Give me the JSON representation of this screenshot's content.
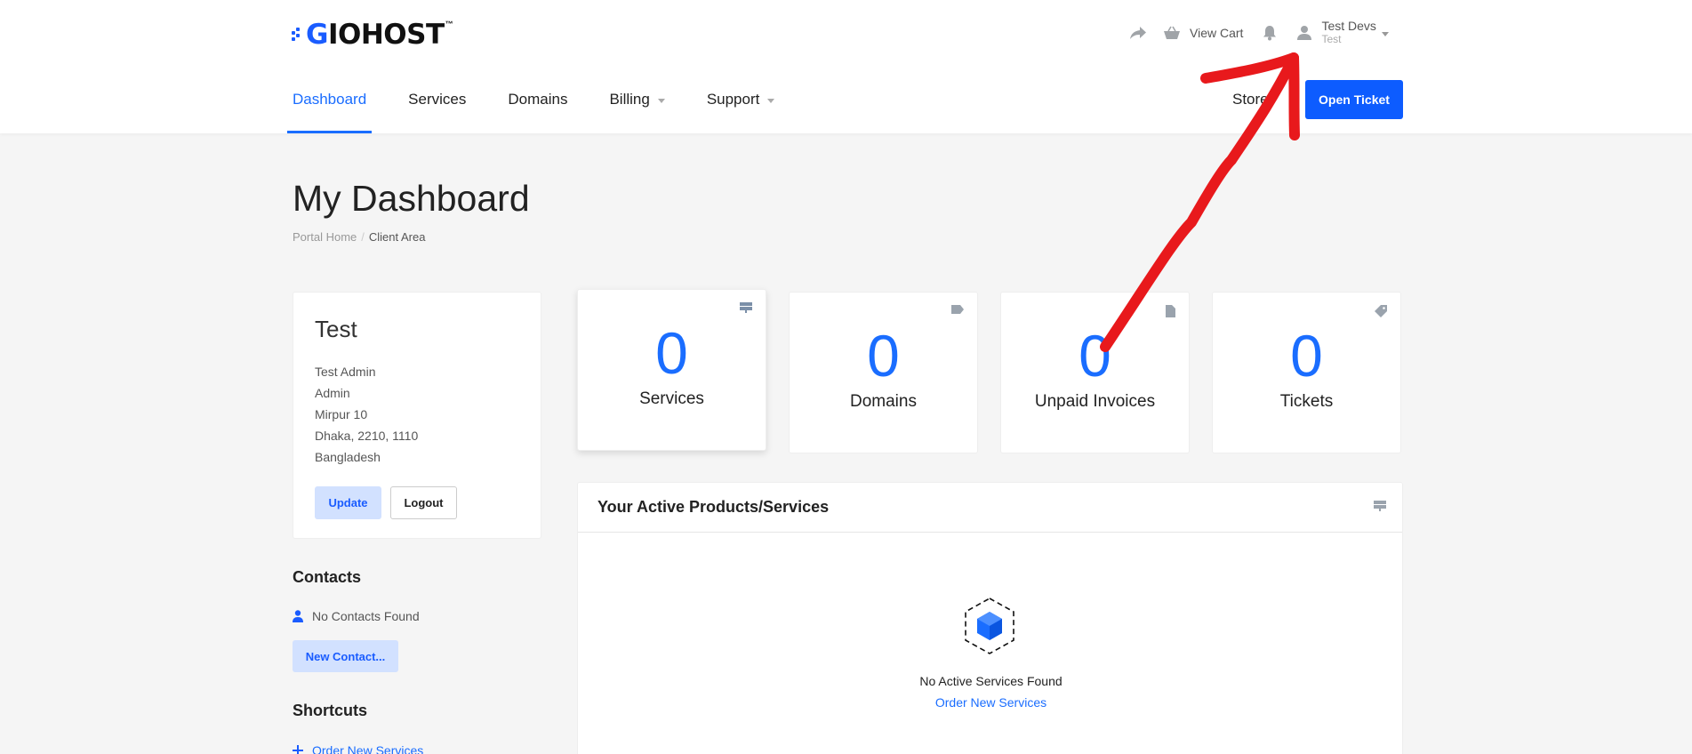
{
  "brand": {
    "logo_text_g": "G",
    "logo_text_rest": "IOHOST",
    "logo_tm": "™",
    "accent": "#1a6dff"
  },
  "header": {
    "view_cart": "View Cart",
    "user_name": "Test Devs",
    "user_sub": "Test",
    "store": "Store",
    "open_ticket": "Open Ticket"
  },
  "nav": {
    "items": [
      {
        "label": "Dashboard",
        "active": true
      },
      {
        "label": "Services"
      },
      {
        "label": "Domains"
      },
      {
        "label": "Billing",
        "dropdown": true
      },
      {
        "label": "Support",
        "dropdown": true
      }
    ]
  },
  "page": {
    "title": "My Dashboard",
    "breadcrumb": {
      "home": "Portal Home",
      "sep": "/",
      "current": "Client Area"
    }
  },
  "profile": {
    "name": "Test",
    "lines": [
      "Test Admin",
      "Admin",
      "Mirpur 10",
      "Dhaka, 2210, 1110",
      "Bangladesh"
    ],
    "update": "Update",
    "logout": "Logout"
  },
  "contacts": {
    "heading": "Contacts",
    "empty": "No Contacts Found",
    "new_button": "New Contact..."
  },
  "shortcuts": {
    "heading": "Shortcuts",
    "order_link": "Order New Services"
  },
  "stats": [
    {
      "value": "0",
      "label": "Services",
      "icon": "server-icon"
    },
    {
      "value": "0",
      "label": "Domains",
      "icon": "tag-icon"
    },
    {
      "value": "0",
      "label": "Unpaid Invoices",
      "icon": "document-icon"
    },
    {
      "value": "0",
      "label": "Tickets",
      "icon": "ticket-icon"
    }
  ],
  "products": {
    "title": "Your Active Products/Services",
    "empty_text": "No Active Services Found",
    "order_link": "Order New Services"
  },
  "annotation": {
    "color": "#e8191c",
    "description_icon": "red-arrow-annotation"
  }
}
